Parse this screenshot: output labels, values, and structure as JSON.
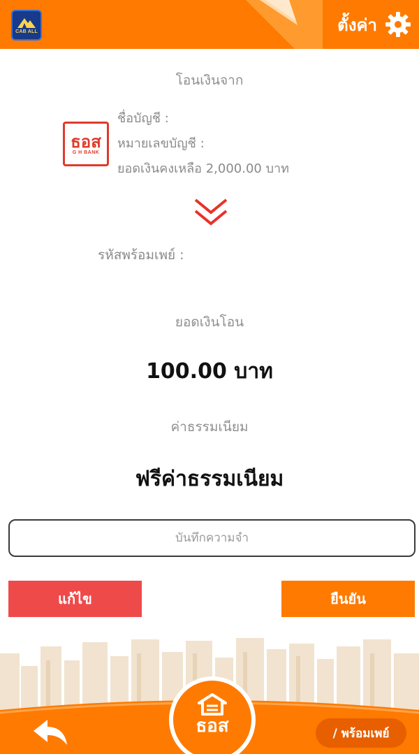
{
  "header": {
    "logo_text": "CAB ALL",
    "settings_label": "ตั้งค่า"
  },
  "transfer_from": {
    "title": "โอนเงินจาก",
    "bank_logo_main": "ธอส",
    "bank_logo_sub": "G H BANK",
    "account_name_label": "ชื่อบัญชี :",
    "account_number_label": "หมายเลขบัญชี :",
    "balance_label": "ยอดเงินคงเหลือ 2,000.00 บาท"
  },
  "transfer_to": {
    "promptpay_label": "รหัสพร้อมเพย์ :"
  },
  "amount": {
    "label": "ยอดเงินโอน",
    "value": "100.00 บาท"
  },
  "fee": {
    "label": "ค่าธรรมเนียม",
    "value": "ฟรีค่าธรรมเนียม"
  },
  "memo": {
    "placeholder": "บันทึกความจำ",
    "value": ""
  },
  "buttons": {
    "edit": "แก้ไข",
    "confirm": "ยืนยัน"
  },
  "bottom_nav": {
    "center_logo_text": "ธอส",
    "promptpay_pill": "/ พร้อมเพย์"
  },
  "colors": {
    "primary_orange": "#ff7a00",
    "edit_red": "#ef4a4a",
    "bank_red": "#e03a2a",
    "logo_blue": "#173a8a"
  }
}
